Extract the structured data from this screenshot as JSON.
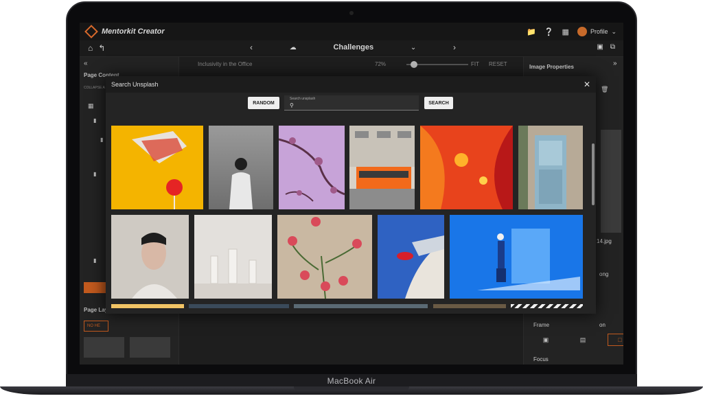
{
  "device": {
    "label": "MacBook Air"
  },
  "app": {
    "title": "Mentorkit Creator",
    "profile": "Profile"
  },
  "toolbar": {
    "page_name": "Challenges"
  },
  "left_panel": {
    "section_title": "Page Content",
    "collapse_label": "COLLAPSE A",
    "layout_title": "Page Lay",
    "layout_button": "NO HE"
  },
  "canvas": {
    "page_tab": "Inclusivity in the Office",
    "zoom": "72%",
    "fit": "FIT",
    "reset": "RESET"
  },
  "right_panel": {
    "title": "Image Properties",
    "file_fragment": "14.jpg",
    "fragment_ong": "ong",
    "fragment_on": "on",
    "frame_label": "Frame",
    "focus_label": "Focus"
  },
  "modal": {
    "title": "Search Unsplash",
    "random_label": "RANDOM",
    "search_label": "Search unsplash",
    "search_placeholder": "",
    "search_button": "SEARCH"
  },
  "colors": {
    "accent": "#c25a1e",
    "background": "#1e1e1e",
    "panel": "#232323"
  },
  "photos": [
    {
      "name": "candy-lollipop",
      "bg": "#f4b400",
      "row": 0
    },
    {
      "name": "woman-beach-bw",
      "bg": "#8c8c8c",
      "row": 0
    },
    {
      "name": "purple-blossoms",
      "bg": "#c7a3d8",
      "row": 0
    },
    {
      "name": "orange-tram",
      "bg": "#d8d2c8",
      "row": 0
    },
    {
      "name": "red-abstract",
      "bg": "#e8431c",
      "row": 0
    },
    {
      "name": "blue-door",
      "bg": "#b7aa97",
      "row": 0
    },
    {
      "name": "veiled-portrait",
      "bg": "#cfcac3",
      "row": 1
    },
    {
      "name": "white-glassware",
      "bg": "#e3e0dc",
      "row": 1
    },
    {
      "name": "red-flowers",
      "bg": "#c9b8a2",
      "row": 1
    },
    {
      "name": "blue-car",
      "bg": "#2f62c2",
      "row": 1
    },
    {
      "name": "blue-wall-person",
      "bg": "#1976e8",
      "row": 1
    }
  ]
}
